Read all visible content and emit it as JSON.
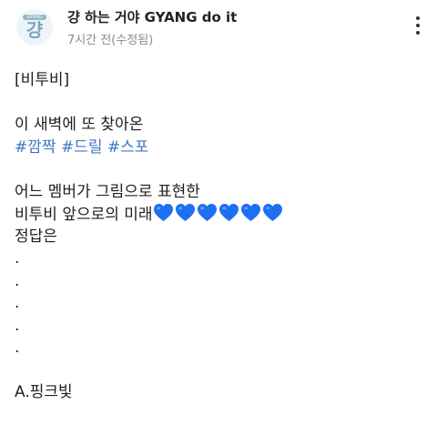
{
  "post": {
    "author": "걍 하는 거야 GYANG do it",
    "time_meta": "7시간 전(수정됨)",
    "avatar_tag": "GYANG",
    "avatar_glyph": "걍",
    "lines": {
      "l1": "[비투비]",
      "l2": "이 새벽에 또 찾아온",
      "hashtags": [
        "#깜짝",
        "#드릴",
        "#스포"
      ],
      "l4": "어느 멤버가 그림으로 표현한",
      "l5": "비투비 앞으로의 미래",
      "l6": "정답은",
      "dot": ".",
      "answer": "A.핑크빛"
    },
    "hearts": {
      "count": 6,
      "color": "#1f6ff2",
      "icon": "blue-heart-emoji"
    }
  },
  "icons": {
    "more": "more-vertical-icon"
  }
}
